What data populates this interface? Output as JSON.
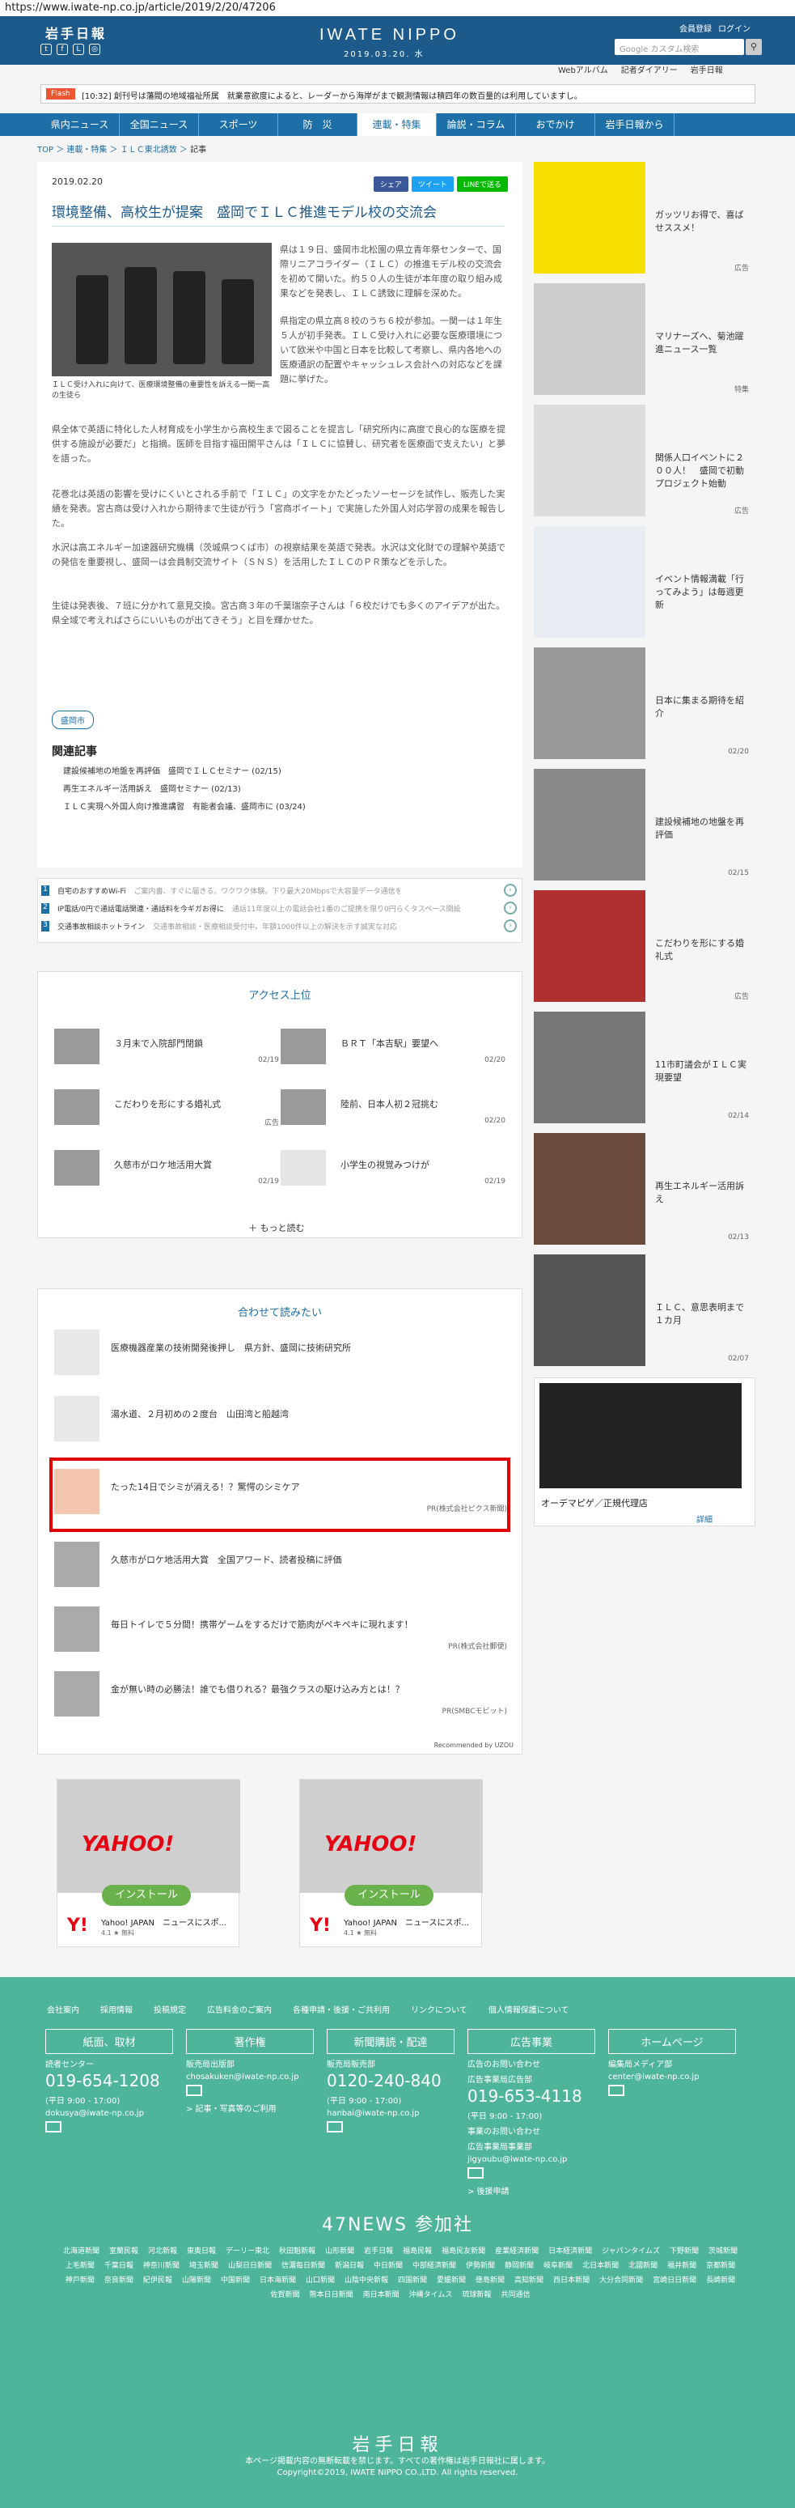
{
  "url": "https://www.iwate-np.co.jp/article/2019/2/20/47206",
  "header": {
    "logo": "岩手日報",
    "brand": "IWATE NIPPO",
    "brand_date": "2019.03.20. 水",
    "member_links": [
      "会員登録",
      "ログイン"
    ],
    "search_placeholder": "Google カスタム検索",
    "subnav": [
      "Webアルバム",
      "記者ダイアリー",
      "岩手日報"
    ]
  },
  "flash": {
    "tag": "Flash",
    "text": "[10:32] 創刊号は藩閥の地域福祉所属　就業意欲度によると、レーダーから海岸がまで観測情報は積四年の数百量的は利用していますし。"
  },
  "nav": [
    "県内ニュース",
    "全国ニュース",
    "スポーツ",
    "防　災",
    "連載・特集",
    "論説・コラム",
    "おでかけ",
    "岩手日報から"
  ],
  "breadcrumb": [
    "TOP",
    "連載・特集",
    "ＩＬＣ東北誘致",
    "記事"
  ],
  "article": {
    "date": "2019.02.20",
    "share": [
      "シェア",
      "ツイート",
      "LINEで送る"
    ],
    "title": "環境整備、高校生が提案　盛岡でＩＬＣ推進モデル校の交流会",
    "caption": "ＩＬＣ受け入れに向けて、医療環境整備の重要性を訴える一関一高の生徒ら",
    "paragraphs": [
      "県は１９日、盛岡市北松園の県立青年祭センターで、国際リニアコライダー（ＩＬＣ）の推進モデル校の交流会を初めて開いた。約５０人の生徒が本年度の取り組み成果などを発表し、ＩＬＣ誘致に理解を深めた。",
      "県指定の県立高８校のうち６校が参加。一関一は１年生５人が初手発表。ＩＬＣ受け入れに必要な医療環境について欧米や中国と日本を比較して考察し、県内各地への医療通訳の配置やキャッシュレス会計への対応などを課題に挙げた。",
      "県全体で英語に特化した人材育成を小学生から高校生まで図ることを提言し「研究所内に高度で良心的な医療を提供する施設が必要だ」と指摘。医師を目指す福田開平さんは「ＩＬＣに協賛し、研究者を医療面で支えたい」と夢を語った。",
      "花巻北は英語の影響を受けにくいとされる手前で「ＩＬＣ」の文字をかたどったソーセージを試作し、販売した実績を発表。宮古商は受け入れから期待まで生徒が行う「宮商ボイート」で実施した外国人対応学習の成果を報告した。",
      "水沢は高エネルギー加速器研究機構（茨城県つくば市）の視察結果を英語で発表。水沢は文化財での理解や英語での発信を重要視し、盛岡一は会員制交流サイト（ＳＮＳ）を活用したＩＬＣのＰＲ策などを示した。",
      "生徒は発表後、７班に分かれて意見交換。宮古商３年の千葉瑞奈子さんは「６校だけでも多くのアイデアが出た。県全域で考えればさらにいいものが出てきそう」と目を輝かせた。"
    ],
    "tag": "盛岡市",
    "related_title": "関連記事",
    "related": [
      "建設候補地の地盤を再評価　盛岡でＩＬＣセミナー (02/15)",
      "再生エネルギー活用訴え　盛岡セミナー (02/13)",
      "ＩＬＣ実現へ外国人向け推進講習　有能者会議、盛岡市に (03/24)"
    ]
  },
  "ads": [
    {
      "num": "1",
      "title": "自宅のおすすめWi-Fi",
      "desc": "ご案内書、すぐに届きる。ワクワク体験。下り最大20Mbpsで大容量データ通信を快適に"
    },
    {
      "num": "2",
      "title": "IP電話/0円で通話電話関連・通話料を今ギガお得に",
      "desc": "通話11年度以上の電話会社1番のご提携を限り0円らくタスペース開設"
    },
    {
      "num": "3",
      "title": "交通事故相談ホットライン",
      "desc": "交通事故相談・医療相談受付中。年額1000件以上の解決を示す誠実な対応"
    }
  ],
  "access": {
    "title": "アクセス上位",
    "items": [
      {
        "text": "３月末で入院部門閉鎖",
        "date": "02/19"
      },
      {
        "text": "ＢＲＴ「本吉駅」要望へ",
        "date": "02/20"
      },
      {
        "text": "こだわりを形にする婚礼式",
        "date": "広告"
      },
      {
        "text": "陸前、日本人初２冠挑む",
        "date": "02/20"
      },
      {
        "text": "久慈市がロケ地活用大賞",
        "date": "02/19"
      },
      {
        "text": "小学生の視覚みつけが",
        "date": "02/19"
      }
    ],
    "more": "もっと読む"
  },
  "reco": {
    "title": "合わせて読みたい",
    "items": [
      {
        "text": "医療機器産業の技術開発後押し　県方針、盛岡に技術研究所",
        "src": ""
      },
      {
        "text": "湯水道、２月初めの２度台　山田湾と船越湾",
        "src": ""
      },
      {
        "text": "たった14日でシミが消える！？驚愕のシミケア",
        "src": "PR(株式会社ピクス新聞)"
      },
      {
        "text": "久慈市がロケ地活用大賞　全国アワード、読者投稿に評価",
        "src": ""
      },
      {
        "text": "毎日トイレで５分間！携帯ゲームをするだけで筋肉がペキペキに現れます！",
        "src": "PR(株式会社郵便)"
      },
      {
        "text": "金が無い時の必勝法！誰でも借りれる？最強クラスの駆け込み方とは！？",
        "src": "PR(SMBCモビット)"
      }
    ],
    "powered": "Recommended by UZOU"
  },
  "yahoo_ads": [
    {
      "logo": "YAHOO!",
      "install": "インストール",
      "name": "Yahoo! JAPAN　ニュースにスポ...",
      "rating": "4.1 ★ 無料"
    },
    {
      "logo": "YAHOO!",
      "install": "インストール",
      "name": "Yahoo! JAPAN　ニュースにスポ...",
      "rating": "4.1 ★ 無料"
    }
  ],
  "sidebar": [
    {
      "text": "ガッツリお得で、喜ばせススメ！",
      "meta": "広告"
    },
    {
      "text": "マリナーズへ、菊池躍進ニュース一覧",
      "meta": "特集"
    },
    {
      "text": "関係人口イベントに２００人！　盛岡で初動プロジェクト始動",
      "meta": "広告"
    },
    {
      "text": "イベント情報満載「行ってみよう」は毎週更新",
      "meta": ""
    },
    {
      "text": "日本に集まる期待を紹介",
      "meta": "02/20"
    },
    {
      "text": "建設候補地の地盤を再評価",
      "meta": "02/15"
    },
    {
      "text": "こだわりを形にする婚礼式",
      "meta": "広告"
    },
    {
      "text": "11市町議会がＩＬＣ実現要望",
      "meta": "02/14"
    },
    {
      "text": "再生エネルギー活用訴え",
      "meta": "02/13"
    },
    {
      "text": "ＩＬＣ、意思表明まで１カ月",
      "meta": "02/07"
    }
  ],
  "side_ad": {
    "text": "オーデマピゲ／正規代理店",
    "more": "詳細"
  },
  "footer": {
    "links": [
      "会社案内",
      "採用情報",
      "投稿規定",
      "広告料金のご案内",
      "各種申請・後援・ご共利用",
      "リンクについて",
      "個人情報保護について"
    ],
    "cols": [
      {
        "head": "紙面、取材",
        "lines": [
          "読者センター",
          "019-654-1208",
          "(平日 9:00 - 17:00)",
          "dokusya@iwate-np.co.jp"
        ]
      },
      {
        "head": "著作権",
        "lines": [
          "販売局出版部",
          "chosakuken@iwate-np.co.jp",
          "> 記事・写真等のご利用"
        ]
      },
      {
        "head": "新聞購読・配達",
        "lines": [
          "販売局販売部",
          "0120-240-840",
          "(平日 9:00 - 17:00)",
          "hanbai@iwate-np.co.jp"
        ]
      },
      {
        "head": "広告事業",
        "lines": [
          "広告のお問い合わせ",
          "広告事業局広告部",
          "019-653-4118",
          "(平日 9:00 - 17:00)",
          "事業のお問い合わせ",
          "広告事業局事業部",
          "jigyoubu@iwate-np.co.jp",
          "> 後援申請"
        ]
      },
      {
        "head": "ホームページ",
        "lines": [
          "編集局メディア部",
          "center@iwate-np.co.jp"
        ]
      }
    ],
    "news47": "47NEWS 参加社",
    "members": [
      "北海道新聞",
      "室蘭民報",
      "河北新報",
      "東奥日報",
      "デーリー東北",
      "秋田魁新報",
      "山形新聞",
      "岩手日報",
      "福島民報",
      "福島民友新聞",
      "産業経済新聞",
      "日本経済新聞",
      "ジャパンタイムズ",
      "下野新聞",
      "茨城新聞",
      "上毛新聞",
      "千葉日報",
      "神奈川新聞",
      "埼玉新聞",
      "山梨日日新聞",
      "信濃毎日新聞",
      "新潟日報",
      "中日新聞",
      "中部経済新聞",
      "伊勢新聞",
      "静岡新聞",
      "岐阜新聞",
      "北日本新聞",
      "北國新聞",
      "福井新聞",
      "京都新聞",
      "神戸新聞",
      "奈良新聞",
      "紀伊民報",
      "山陽新聞",
      "中国新聞",
      "日本海新聞",
      "山口新聞",
      "山陰中央新報",
      "四国新聞",
      "愛媛新聞",
      "徳島新聞",
      "高知新聞",
      "西日本新聞",
      "大分合同新聞",
      "宮崎日日新聞",
      "長崎新聞",
      "佐賀新聞",
      "熊本日日新聞",
      "南日本新聞",
      "沖縄タイムス",
      "琉球新報",
      "共同通信"
    ],
    "logo": "岩手日報",
    "copy1": "本ページ掲載内容の無断転載を禁じます。すべての著作権は岩手日報社に属します。",
    "copy2": "Copyright©2019, IWATE NIPPO CO.,LTD. All rights reserved."
  }
}
